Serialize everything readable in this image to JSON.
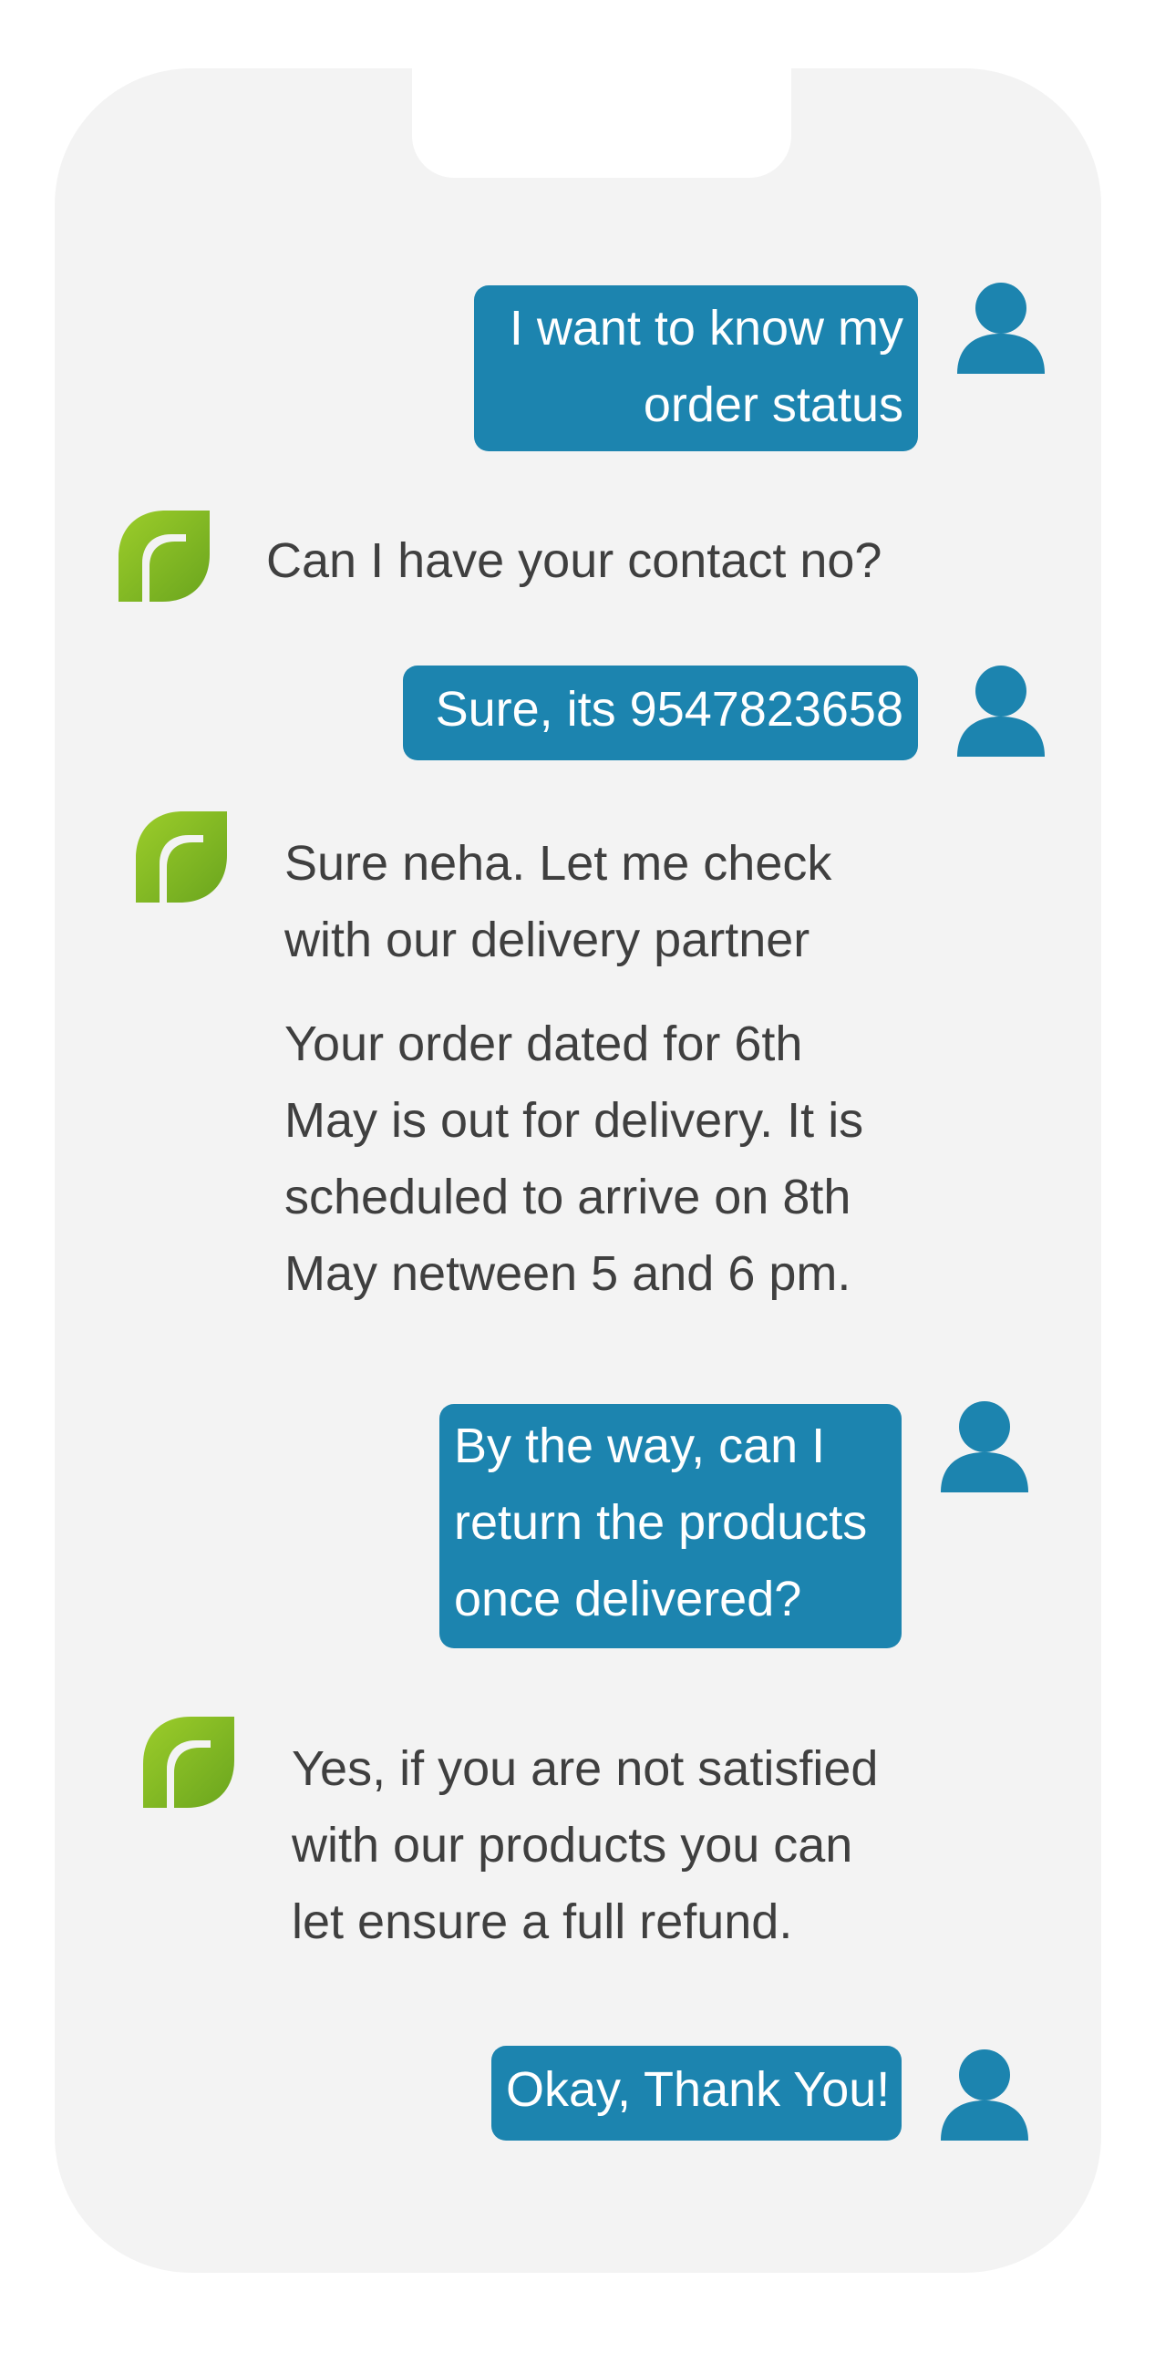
{
  "colors": {
    "phone_bg": "#f3f3f3",
    "user_bubble": "#1c84af",
    "user_icon": "#1c84af",
    "bot_icon_light": "#9ccd2a",
    "bot_icon_dark": "#6aa51e",
    "bot_text": "#3f3f3f"
  },
  "icons": {
    "user": "user-avatar-icon",
    "bot": "leaf-logo-icon"
  },
  "messages": [
    {
      "sender": "user",
      "lines": [
        "I want to know my",
        "order status"
      ]
    },
    {
      "sender": "bot",
      "lines": [
        "Can I have your contact no?"
      ]
    },
    {
      "sender": "user",
      "lines": [
        "Sure, its 9547823658"
      ]
    },
    {
      "sender": "bot",
      "lines": [
        "Sure neha. Let me check",
        "with our delivery partner"
      ]
    },
    {
      "sender": "bot",
      "lines": [
        "Your order dated for 6th",
        "May  is out for delivery. It is",
        "scheduled to arrive on 8th",
        "May netween 5 and 6 pm."
      ]
    },
    {
      "sender": "user",
      "lines": [
        "By the way, can I",
        "return the products",
        "once delivered?"
      ]
    },
    {
      "sender": "bot",
      "lines": [
        "Yes, if you are not satisfied",
        "with our products you can",
        "let ensure a full refund."
      ]
    },
    {
      "sender": "user",
      "lines": [
        "Okay, Thank You!"
      ]
    }
  ]
}
